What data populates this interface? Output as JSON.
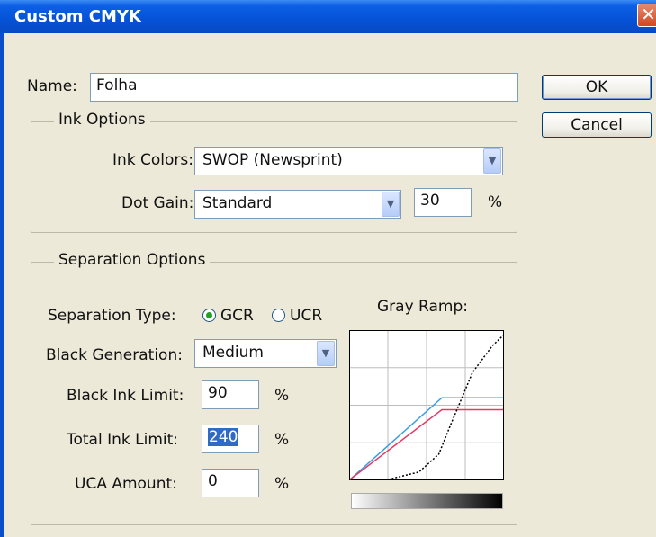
{
  "window": {
    "title": "Custom CMYK"
  },
  "name_field": {
    "label": "Name:",
    "value": "Folha"
  },
  "buttons": {
    "ok": "OK",
    "cancel": "Cancel"
  },
  "ink_options": {
    "legend": "Ink Options",
    "ink_colors_label": "Ink Colors:",
    "ink_colors_value": "SWOP (Newsprint)",
    "dot_gain_label": "Dot Gain:",
    "dot_gain_value": "Standard",
    "dot_gain_amount": "30",
    "dot_gain_unit": "%"
  },
  "separation_options": {
    "legend": "Separation Options",
    "type_label": "Separation Type:",
    "gcr_label": "GCR",
    "ucr_label": "UCR",
    "selected_type": "GCR",
    "black_generation_label": "Black Generation:",
    "black_generation_value": "Medium",
    "black_ink_limit_label": "Black Ink Limit:",
    "black_ink_limit_value": "90",
    "black_ink_limit_unit": "%",
    "total_ink_limit_label": "Total Ink Limit:",
    "total_ink_limit_value": "240",
    "total_ink_limit_unit": "%",
    "uca_amount_label": "UCA Amount:",
    "uca_amount_value": "0",
    "uca_amount_unit": "%"
  },
  "gray_ramp": {
    "label": "Gray Ramp:",
    "curves": [
      {
        "name": "cyan",
        "color": "#3b9be6",
        "points": [
          [
            0,
            0
          ],
          [
            0.6,
            0.55
          ],
          [
            1,
            0.55
          ]
        ]
      },
      {
        "name": "magenta",
        "color": "#e33c64",
        "points": [
          [
            0,
            0
          ],
          [
            0.6,
            0.47
          ],
          [
            1,
            0.47
          ]
        ]
      },
      {
        "name": "black",
        "color": "#000000",
        "dashed": true,
        "points": [
          [
            0.25,
            0
          ],
          [
            0.45,
            0.05
          ],
          [
            0.58,
            0.17
          ],
          [
            0.65,
            0.35
          ],
          [
            0.8,
            0.72
          ],
          [
            0.93,
            0.9
          ],
          [
            1,
            0.97
          ]
        ]
      }
    ]
  },
  "icons": {
    "close": "close-icon",
    "dropdown": "chevron-down-icon"
  }
}
